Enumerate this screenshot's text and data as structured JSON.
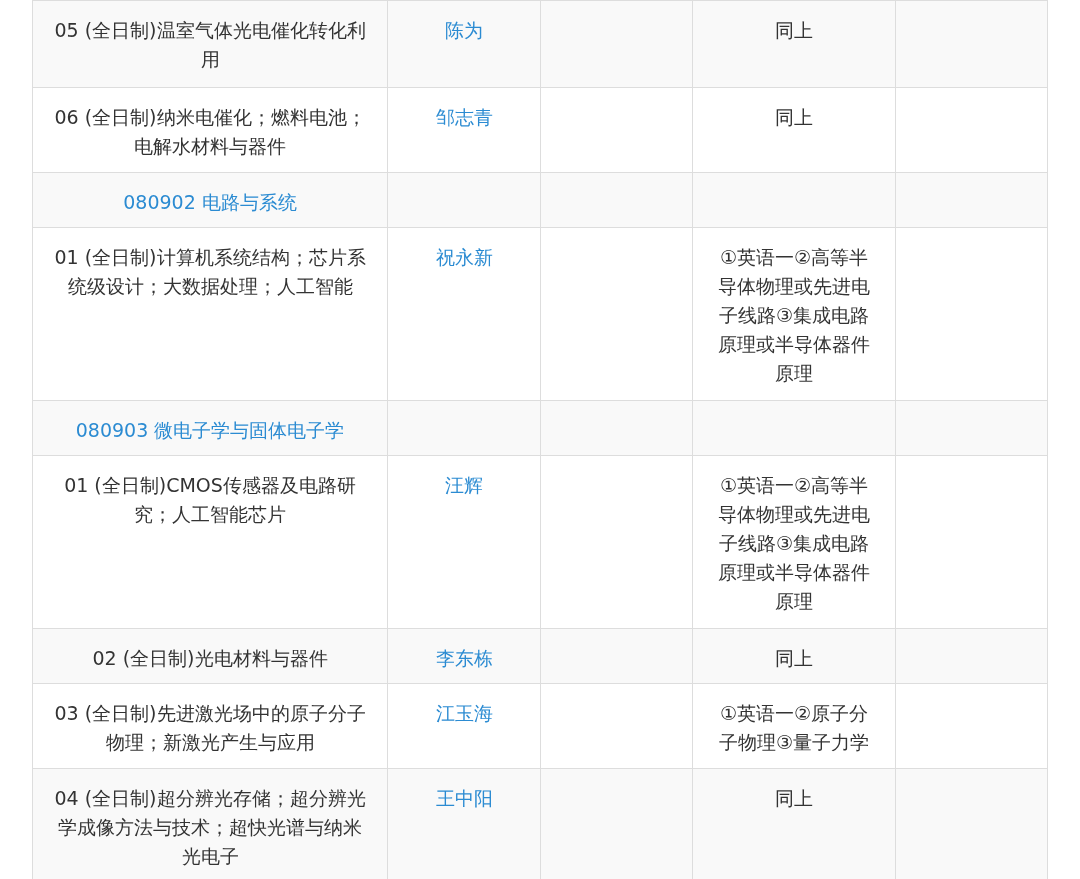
{
  "table": {
    "rows": [
      {
        "kind": "direction",
        "direction": "05 (全日制)温室气体光电催化转化利用",
        "advisor": "陈为",
        "exam": "同上"
      },
      {
        "kind": "direction",
        "direction": "06 (全日制)纳米电催化；燃料电池；电解水材料与器件",
        "advisor": "邹志青",
        "exam": "同上"
      },
      {
        "kind": "major",
        "direction": "080902 电路与系统"
      },
      {
        "kind": "direction",
        "direction": "01 (全日制)计算机系统结构；芯片系统级设计；大数据处理；人工智能",
        "advisor": "祝永新",
        "exam": "①英语一②高等半导体物理或先进电子线路③集成电路原理或半导体器件原理"
      },
      {
        "kind": "major",
        "direction": "080903 微电子学与固体电子学"
      },
      {
        "kind": "direction",
        "direction": "01 (全日制)CMOS传感器及电路研究；人工智能芯片",
        "advisor": "汪辉",
        "exam": "①英语一②高等半导体物理或先进电子线路③集成电路原理或半导体器件原理"
      },
      {
        "kind": "direction",
        "direction": "02 (全日制)光电材料与器件",
        "advisor": "李东栋",
        "exam": "同上"
      },
      {
        "kind": "direction",
        "direction": "03 (全日制)先进激光场中的原子分子物理；新激光产生与应用",
        "advisor": "江玉海",
        "exam": "①英语一②原子分子物理③量子力学"
      },
      {
        "kind": "direction",
        "direction": "04 (全日制)超分辨光存储；超分辨光学成像方法与技术；超快光谱与纳米光电子",
        "advisor": "王中阳",
        "exam": "同上"
      }
    ]
  }
}
